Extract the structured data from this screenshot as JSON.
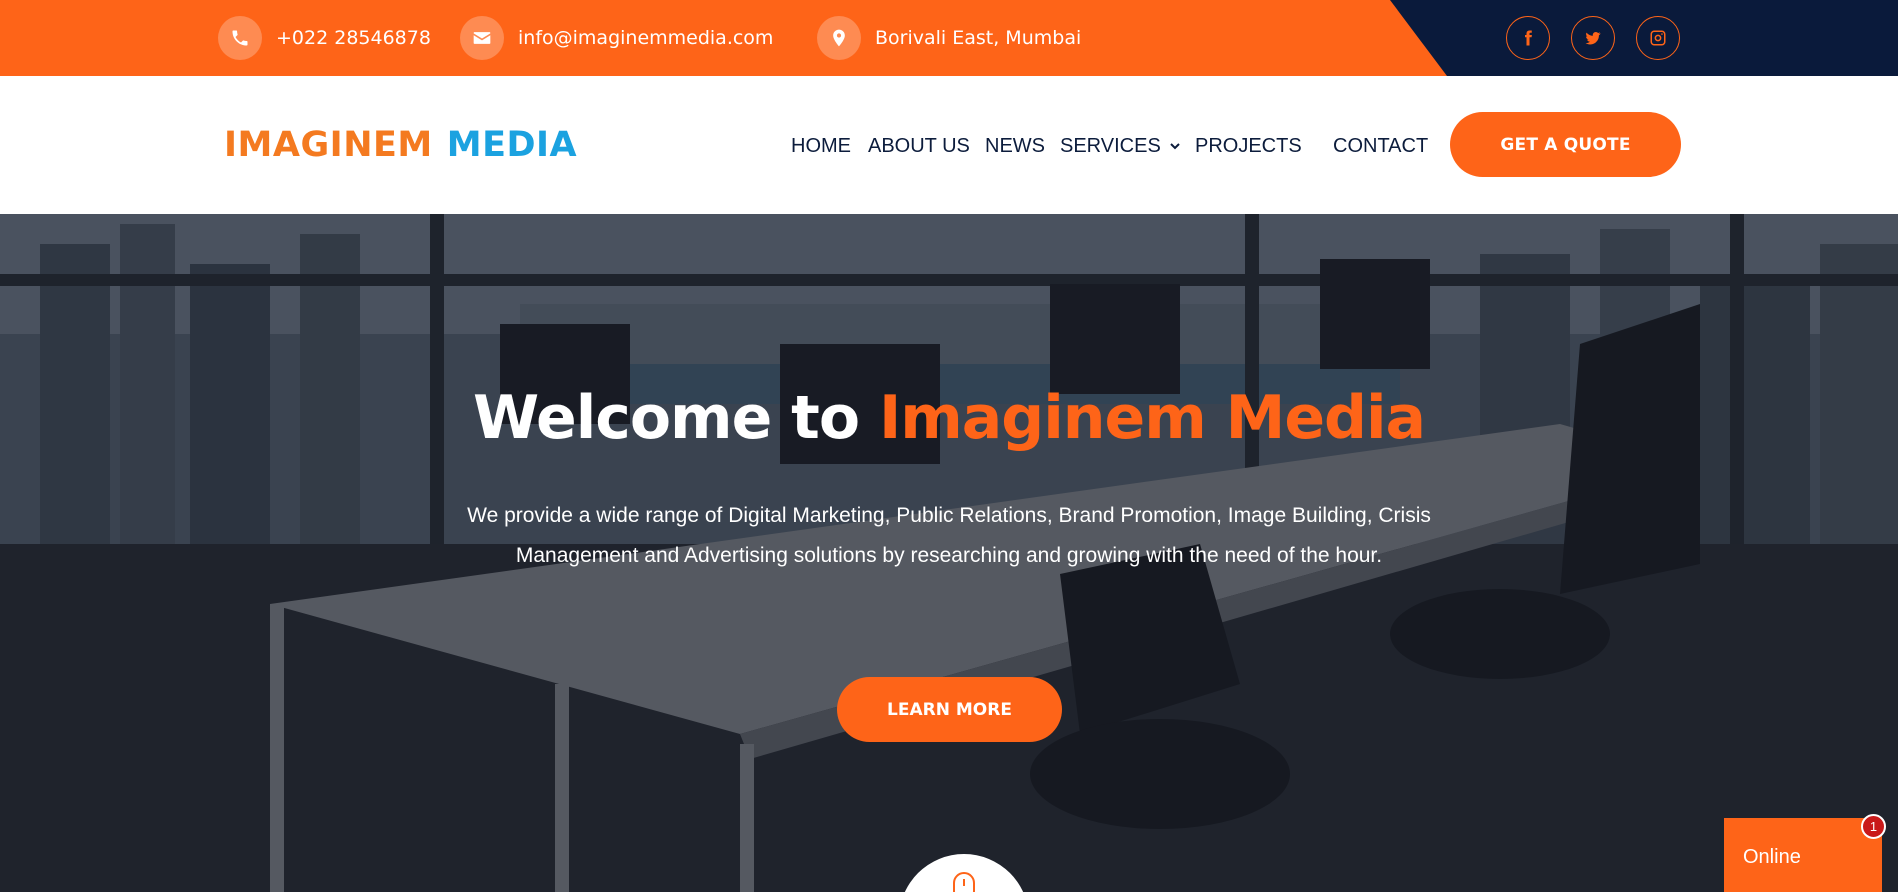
{
  "topbar": {
    "phone": "+022 28546878",
    "email": "info@imaginemmedia.com",
    "location": "Borivali East, Mumbai",
    "phone_icon": "phone-icon",
    "email_icon": "envelope-icon",
    "location_icon": "map-pin-icon",
    "social": [
      "facebook-icon",
      "twitter-icon",
      "instagram-icon"
    ]
  },
  "logo": {
    "word1": "IMAGINEM",
    "word2": "MEDIA"
  },
  "nav": {
    "home": "HOME",
    "about": "ABOUT US",
    "news": "NEWS",
    "services": "SERVICES",
    "projects": "PROJECTS",
    "contact": "CONTACT",
    "quote": "GET A QUOTE"
  },
  "hero": {
    "title_prefix": "Welcome to",
    "title_accent": "Imaginem Media",
    "description": "We provide a wide range of Digital Marketing, Public Relations, Brand Promotion, Image Building, Crisis Management and Advertising solutions by researching and growing with the need of the hour.",
    "cta": "LEARN MORE"
  },
  "chat": {
    "label": "Online",
    "badge": "1"
  },
  "colors": {
    "accent": "#fe6418",
    "navy": "#0a1a3b",
    "logo_orange": "#f47a20",
    "logo_blue": "#1ba2e0"
  }
}
